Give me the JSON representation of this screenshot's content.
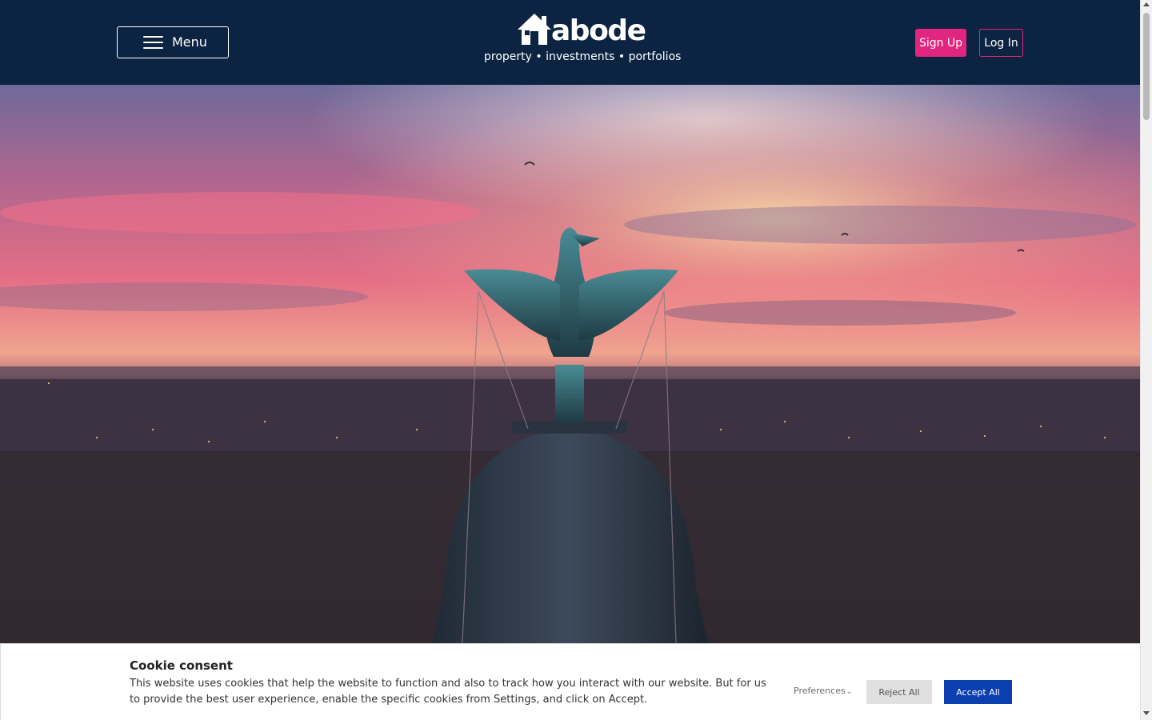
{
  "header": {
    "menu_label": "Menu",
    "logo_text": "abode",
    "tagline": "property • investments • portfolios",
    "signup_label": "Sign Up",
    "login_label": "Log In",
    "background_color": "#0c2442",
    "accent_color": "#e2267f"
  },
  "hero": {
    "image_subject": "liver-bird-statue-at-sunset"
  },
  "cookie_banner": {
    "title": "Cookie consent",
    "text": "This website uses cookies that help the website to function and also to track how you interact with our website. But for us to provide the best user experience, enable the specific cookies from Settings, and click on Accept.",
    "preferences_label": "Preferences",
    "reject_label": "Reject All",
    "accept_label": "Accept All",
    "accept_color": "#0b3fb0"
  },
  "icons": {
    "menu": "hamburger-icon",
    "logo": "house-icon",
    "preferences": "chevron-down-icon"
  }
}
